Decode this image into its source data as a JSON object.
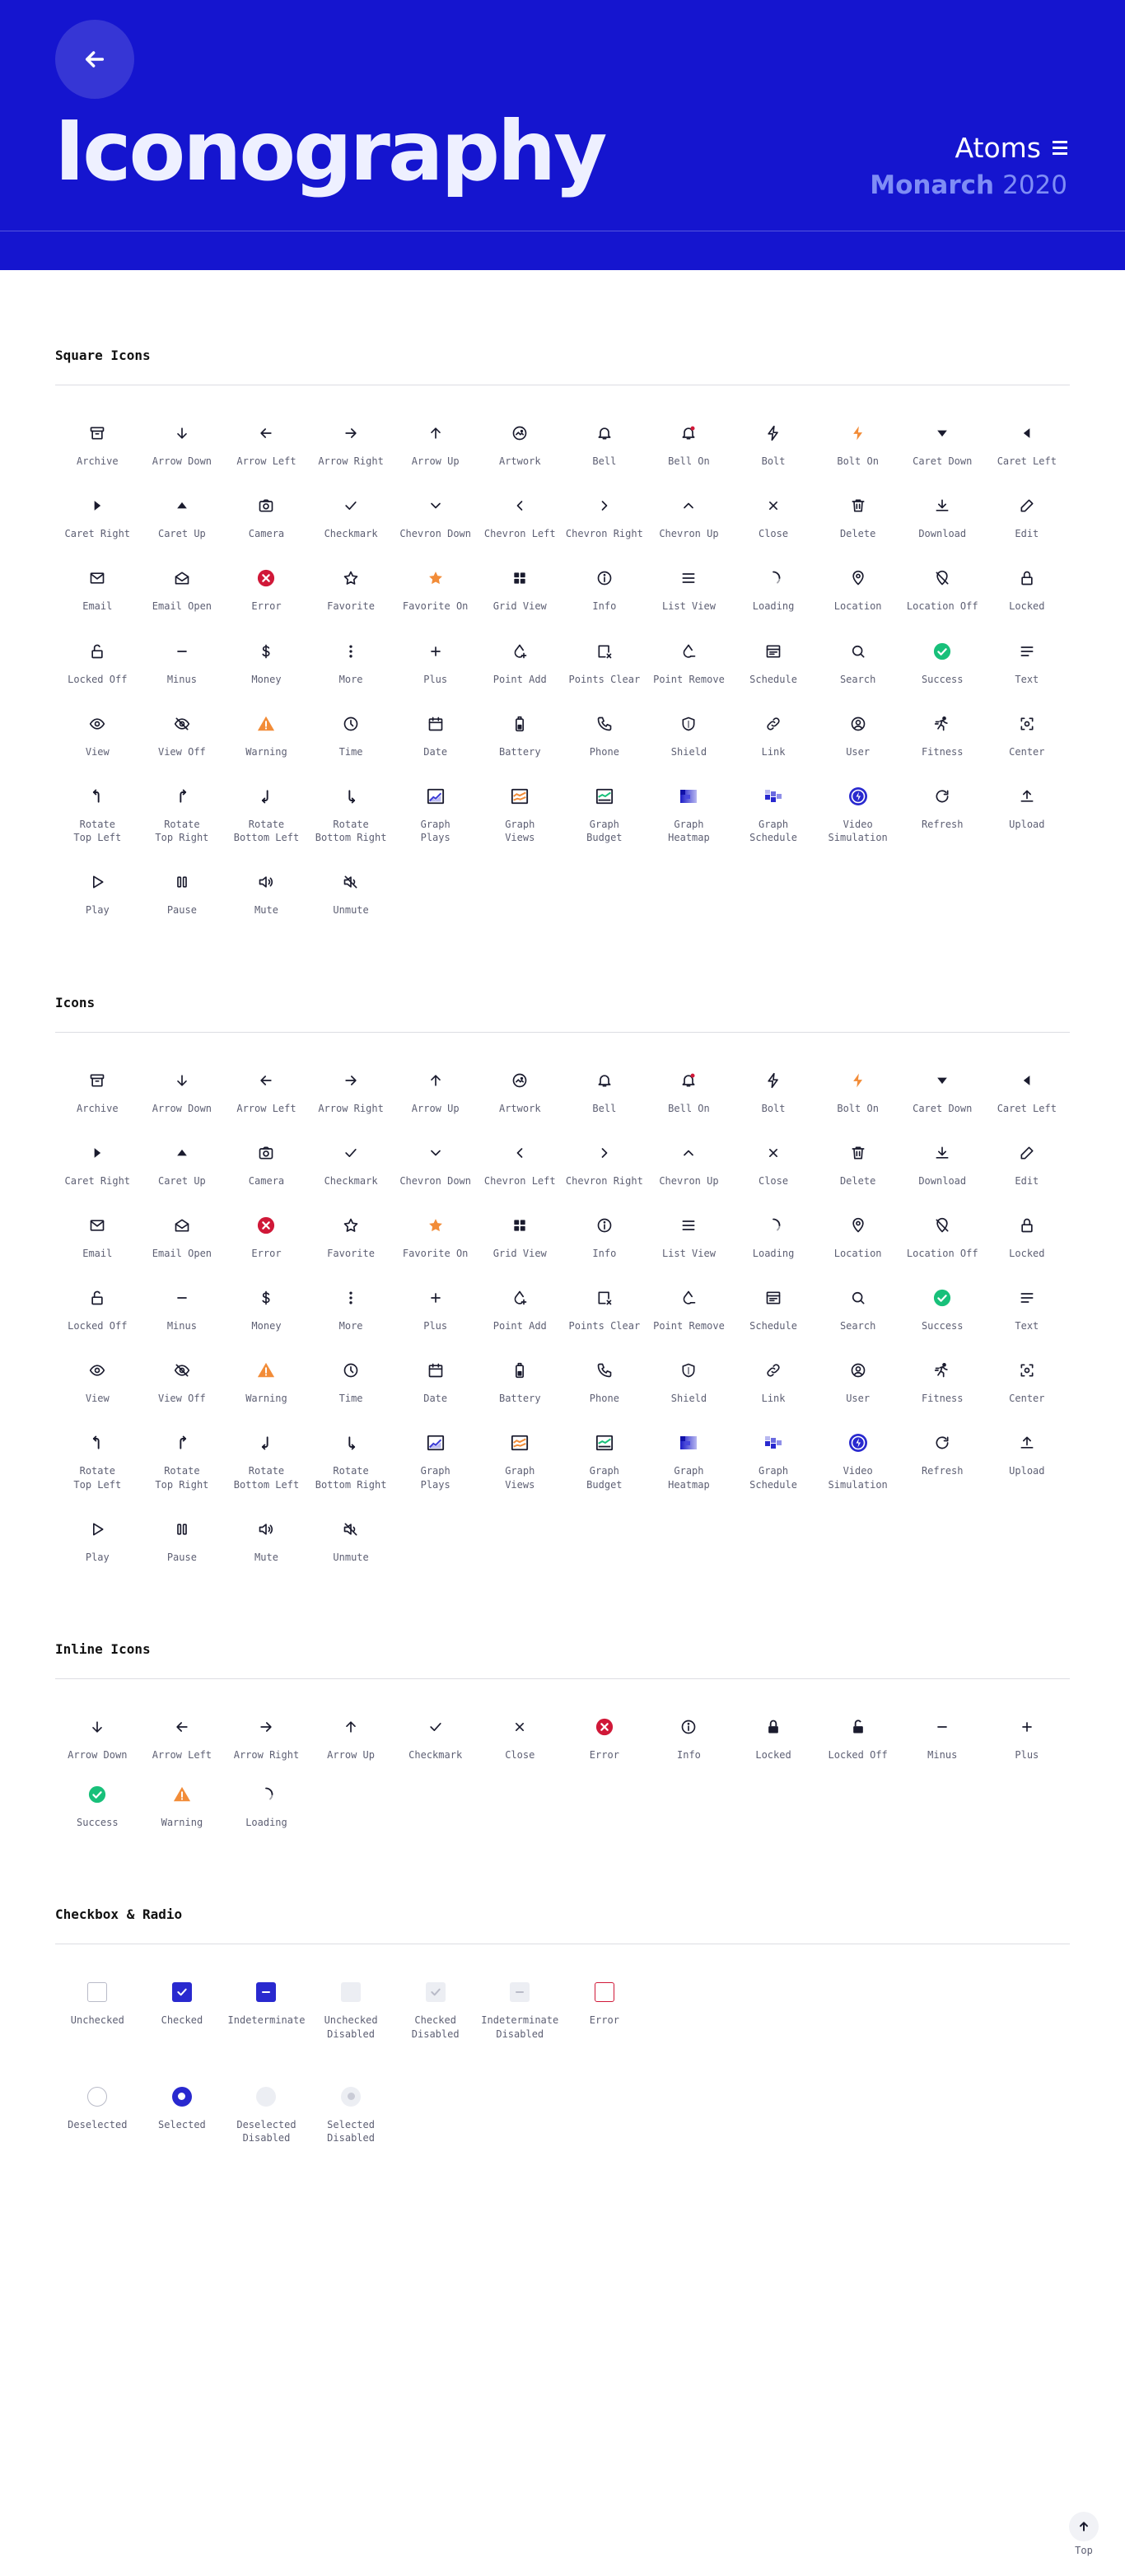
{
  "header": {
    "title": "Iconography",
    "menu_label": "Atoms",
    "brand": "Monarch",
    "year": "2020"
  },
  "colors": {
    "header_bg": "#1515cf",
    "accent": "#2929cf",
    "error": "#d01838",
    "success": "#18c07a",
    "warning": "#f28c38",
    "disabled": "#eceef3"
  },
  "sections": [
    {
      "title": "Square Icons",
      "items": [
        {
          "label": "Archive",
          "icon": "archive"
        },
        {
          "label": "Arrow Down",
          "icon": "arrow-down"
        },
        {
          "label": "Arrow Left",
          "icon": "arrow-left"
        },
        {
          "label": "Arrow Right",
          "icon": "arrow-right"
        },
        {
          "label": "Arrow Up",
          "icon": "arrow-up"
        },
        {
          "label": "Artwork",
          "icon": "artwork"
        },
        {
          "label": "Bell",
          "icon": "bell"
        },
        {
          "label": "Bell On",
          "icon": "bell-on"
        },
        {
          "label": "Bolt",
          "icon": "bolt"
        },
        {
          "label": "Bolt On",
          "icon": "bolt-on"
        },
        {
          "label": "Caret Down",
          "icon": "caret-down"
        },
        {
          "label": "Caret Left",
          "icon": "caret-left"
        },
        {
          "label": "Caret Right",
          "icon": "caret-right"
        },
        {
          "label": "Caret Up",
          "icon": "caret-up"
        },
        {
          "label": "Camera",
          "icon": "camera"
        },
        {
          "label": "Checkmark",
          "icon": "checkmark"
        },
        {
          "label": "Chevron Down",
          "icon": "chevron-down"
        },
        {
          "label": "Chevron Left",
          "icon": "chevron-left"
        },
        {
          "label": "Chevron Right",
          "icon": "chevron-right"
        },
        {
          "label": "Chevron Up",
          "icon": "chevron-up"
        },
        {
          "label": "Close",
          "icon": "close"
        },
        {
          "label": "Delete",
          "icon": "delete"
        },
        {
          "label": "Download",
          "icon": "download"
        },
        {
          "label": "Edit",
          "icon": "edit"
        },
        {
          "label": "Email",
          "icon": "email"
        },
        {
          "label": "Email Open",
          "icon": "email-open"
        },
        {
          "label": "Error",
          "icon": "error"
        },
        {
          "label": "Favorite",
          "icon": "favorite"
        },
        {
          "label": "Favorite On",
          "icon": "favorite-on"
        },
        {
          "label": "Grid View",
          "icon": "grid-view"
        },
        {
          "label": "Info",
          "icon": "info"
        },
        {
          "label": "List View",
          "icon": "list-view"
        },
        {
          "label": "Loading",
          "icon": "loading"
        },
        {
          "label": "Location",
          "icon": "location"
        },
        {
          "label": "Location Off",
          "icon": "location-off"
        },
        {
          "label": "Locked",
          "icon": "locked"
        },
        {
          "label": "Locked Off",
          "icon": "locked-off"
        },
        {
          "label": "Minus",
          "icon": "minus"
        },
        {
          "label": "Money",
          "icon": "money"
        },
        {
          "label": "More",
          "icon": "more"
        },
        {
          "label": "Plus",
          "icon": "plus"
        },
        {
          "label": "Point Add",
          "icon": "point-add"
        },
        {
          "label": "Points Clear",
          "icon": "points-clear"
        },
        {
          "label": "Point Remove",
          "icon": "point-remove"
        },
        {
          "label": "Schedule",
          "icon": "schedule"
        },
        {
          "label": "Search",
          "icon": "search"
        },
        {
          "label": "Success",
          "icon": "success"
        },
        {
          "label": "Text",
          "icon": "text"
        },
        {
          "label": "View",
          "icon": "view"
        },
        {
          "label": "View Off",
          "icon": "view-off"
        },
        {
          "label": "Warning",
          "icon": "warning"
        },
        {
          "label": "Time",
          "icon": "time"
        },
        {
          "label": "Date",
          "icon": "date"
        },
        {
          "label": "Battery",
          "icon": "battery"
        },
        {
          "label": "Phone",
          "icon": "phone"
        },
        {
          "label": "Shield",
          "icon": "shield"
        },
        {
          "label": "Link",
          "icon": "link"
        },
        {
          "label": "User",
          "icon": "user"
        },
        {
          "label": "Fitness",
          "icon": "fitness"
        },
        {
          "label": "Center",
          "icon": "center"
        },
        {
          "label": "Rotate\nTop Left",
          "icon": "rotate-top-left"
        },
        {
          "label": "Rotate\nTop Right",
          "icon": "rotate-top-right"
        },
        {
          "label": "Rotate\nBottom Left",
          "icon": "rotate-bottom-left"
        },
        {
          "label": "Rotate\nBottom Right",
          "icon": "rotate-bottom-right"
        },
        {
          "label": "Graph\nPlays",
          "icon": "graph-plays"
        },
        {
          "label": "Graph\nViews",
          "icon": "graph-views"
        },
        {
          "label": "Graph\nBudget",
          "icon": "graph-budget"
        },
        {
          "label": "Graph\nHeatmap",
          "icon": "graph-heatmap"
        },
        {
          "label": "Graph\nSchedule",
          "icon": "graph-schedule"
        },
        {
          "label": "Video\nSimulation",
          "icon": "video-simulation"
        },
        {
          "label": "Refresh",
          "icon": "refresh"
        },
        {
          "label": "Upload",
          "icon": "upload"
        },
        {
          "label": "Play",
          "icon": "play"
        },
        {
          "label": "Pause",
          "icon": "pause"
        },
        {
          "label": "Mute",
          "icon": "mute"
        },
        {
          "label": "Unmute",
          "icon": "unmute"
        }
      ]
    },
    {
      "title": "Icons",
      "items": [
        {
          "label": "Archive",
          "icon": "archive"
        },
        {
          "label": "Arrow Down",
          "icon": "arrow-down"
        },
        {
          "label": "Arrow Left",
          "icon": "arrow-left"
        },
        {
          "label": "Arrow Right",
          "icon": "arrow-right"
        },
        {
          "label": "Arrow Up",
          "icon": "arrow-up"
        },
        {
          "label": "Artwork",
          "icon": "artwork"
        },
        {
          "label": "Bell",
          "icon": "bell"
        },
        {
          "label": "Bell On",
          "icon": "bell-on"
        },
        {
          "label": "Bolt",
          "icon": "bolt"
        },
        {
          "label": "Bolt On",
          "icon": "bolt-on"
        },
        {
          "label": "Caret Down",
          "icon": "caret-down"
        },
        {
          "label": "Caret Left",
          "icon": "caret-left"
        },
        {
          "label": "Caret Right",
          "icon": "caret-right"
        },
        {
          "label": "Caret Up",
          "icon": "caret-up"
        },
        {
          "label": "Camera",
          "icon": "camera"
        },
        {
          "label": "Checkmark",
          "icon": "checkmark"
        },
        {
          "label": "Chevron Down",
          "icon": "chevron-down"
        },
        {
          "label": "Chevron Left",
          "icon": "chevron-left"
        },
        {
          "label": "Chevron Right",
          "icon": "chevron-right"
        },
        {
          "label": "Chevron Up",
          "icon": "chevron-up"
        },
        {
          "label": "Close",
          "icon": "close"
        },
        {
          "label": "Delete",
          "icon": "delete"
        },
        {
          "label": "Download",
          "icon": "download"
        },
        {
          "label": "Edit",
          "icon": "edit"
        },
        {
          "label": "Email",
          "icon": "email"
        },
        {
          "label": "Email Open",
          "icon": "email-open"
        },
        {
          "label": "Error",
          "icon": "error"
        },
        {
          "label": "Favorite",
          "icon": "favorite"
        },
        {
          "label": "Favorite On",
          "icon": "favorite-on"
        },
        {
          "label": "Grid View",
          "icon": "grid-view"
        },
        {
          "label": "Info",
          "icon": "info"
        },
        {
          "label": "List View",
          "icon": "list-view"
        },
        {
          "label": "Loading",
          "icon": "loading"
        },
        {
          "label": "Location",
          "icon": "location"
        },
        {
          "label": "Location Off",
          "icon": "location-off"
        },
        {
          "label": "Locked",
          "icon": "locked"
        },
        {
          "label": "Locked Off",
          "icon": "locked-off"
        },
        {
          "label": "Minus",
          "icon": "minus"
        },
        {
          "label": "Money",
          "icon": "money"
        },
        {
          "label": "More",
          "icon": "more"
        },
        {
          "label": "Plus",
          "icon": "plus"
        },
        {
          "label": "Point Add",
          "icon": "point-add"
        },
        {
          "label": "Points Clear",
          "icon": "points-clear"
        },
        {
          "label": "Point Remove",
          "icon": "point-remove"
        },
        {
          "label": "Schedule",
          "icon": "schedule"
        },
        {
          "label": "Search",
          "icon": "search"
        },
        {
          "label": "Success",
          "icon": "success"
        },
        {
          "label": "Text",
          "icon": "text"
        },
        {
          "label": "View",
          "icon": "view"
        },
        {
          "label": "View Off",
          "icon": "view-off"
        },
        {
          "label": "Warning",
          "icon": "warning"
        },
        {
          "label": "Time",
          "icon": "time"
        },
        {
          "label": "Date",
          "icon": "date"
        },
        {
          "label": "Battery",
          "icon": "battery"
        },
        {
          "label": "Phone",
          "icon": "phone"
        },
        {
          "label": "Shield",
          "icon": "shield"
        },
        {
          "label": "Link",
          "icon": "link"
        },
        {
          "label": "User",
          "icon": "user"
        },
        {
          "label": "Fitness",
          "icon": "fitness"
        },
        {
          "label": "Center",
          "icon": "center"
        },
        {
          "label": "Rotate\nTop Left",
          "icon": "rotate-top-left"
        },
        {
          "label": "Rotate\nTop Right",
          "icon": "rotate-top-right"
        },
        {
          "label": "Rotate\nBottom Left",
          "icon": "rotate-bottom-left"
        },
        {
          "label": "Rotate\nBottom Right",
          "icon": "rotate-bottom-right"
        },
        {
          "label": "Graph\nPlays",
          "icon": "graph-plays"
        },
        {
          "label": "Graph\nViews",
          "icon": "graph-views"
        },
        {
          "label": "Graph\nBudget",
          "icon": "graph-budget"
        },
        {
          "label": "Graph\nHeatmap",
          "icon": "graph-heatmap"
        },
        {
          "label": "Graph\nSchedule",
          "icon": "graph-schedule"
        },
        {
          "label": "Video\nSimulation",
          "icon": "video-simulation"
        },
        {
          "label": "Refresh",
          "icon": "refresh"
        },
        {
          "label": "Upload",
          "icon": "upload"
        },
        {
          "label": "Play",
          "icon": "play"
        },
        {
          "label": "Pause",
          "icon": "pause"
        },
        {
          "label": "Mute",
          "icon": "mute"
        },
        {
          "label": "Unmute",
          "icon": "unmute"
        }
      ]
    },
    {
      "title": "Inline Icons",
      "items": [
        {
          "label": "Arrow Down",
          "icon": "arrow-down"
        },
        {
          "label": "Arrow Left",
          "icon": "arrow-left"
        },
        {
          "label": "Arrow Right",
          "icon": "arrow-right"
        },
        {
          "label": "Arrow Up",
          "icon": "arrow-up"
        },
        {
          "label": "Checkmark",
          "icon": "checkmark"
        },
        {
          "label": "Close",
          "icon": "close"
        },
        {
          "label": "Error",
          "icon": "error"
        },
        {
          "label": "Info",
          "icon": "info"
        },
        {
          "label": "Locked",
          "icon": "locked-solid"
        },
        {
          "label": "Locked Off",
          "icon": "locked-off-solid"
        },
        {
          "label": "Minus",
          "icon": "minus"
        },
        {
          "label": "Plus",
          "icon": "plus"
        },
        {
          "label": "Success",
          "icon": "success"
        },
        {
          "label": "Warning",
          "icon": "warning"
        },
        {
          "label": "Loading",
          "icon": "loading"
        }
      ]
    },
    {
      "title": "Checkbox & Radio",
      "items": [
        {
          "label": "Unchecked",
          "icon": "cb-unchecked"
        },
        {
          "label": "Checked",
          "icon": "cb-checked"
        },
        {
          "label": "Indeterminate",
          "icon": "cb-indeterminate"
        },
        {
          "label": "Unchecked\nDisabled",
          "icon": "cb-unchecked-disabled"
        },
        {
          "label": "Checked\nDisabled",
          "icon": "cb-checked-disabled"
        },
        {
          "label": "Indeterminate\nDisabled",
          "icon": "cb-indeterminate-disabled"
        },
        {
          "label": "Error",
          "icon": "cb-error"
        },
        {
          "break": true
        },
        {
          "label": "Deselected",
          "icon": "rd-deselected"
        },
        {
          "label": "Selected",
          "icon": "rd-selected"
        },
        {
          "label": "Deselected\nDisabled",
          "icon": "rd-deselected-disabled"
        },
        {
          "label": "Selected\nDisabled",
          "icon": "rd-selected-disabled"
        }
      ]
    }
  ],
  "top_button": {
    "label": "Top"
  }
}
